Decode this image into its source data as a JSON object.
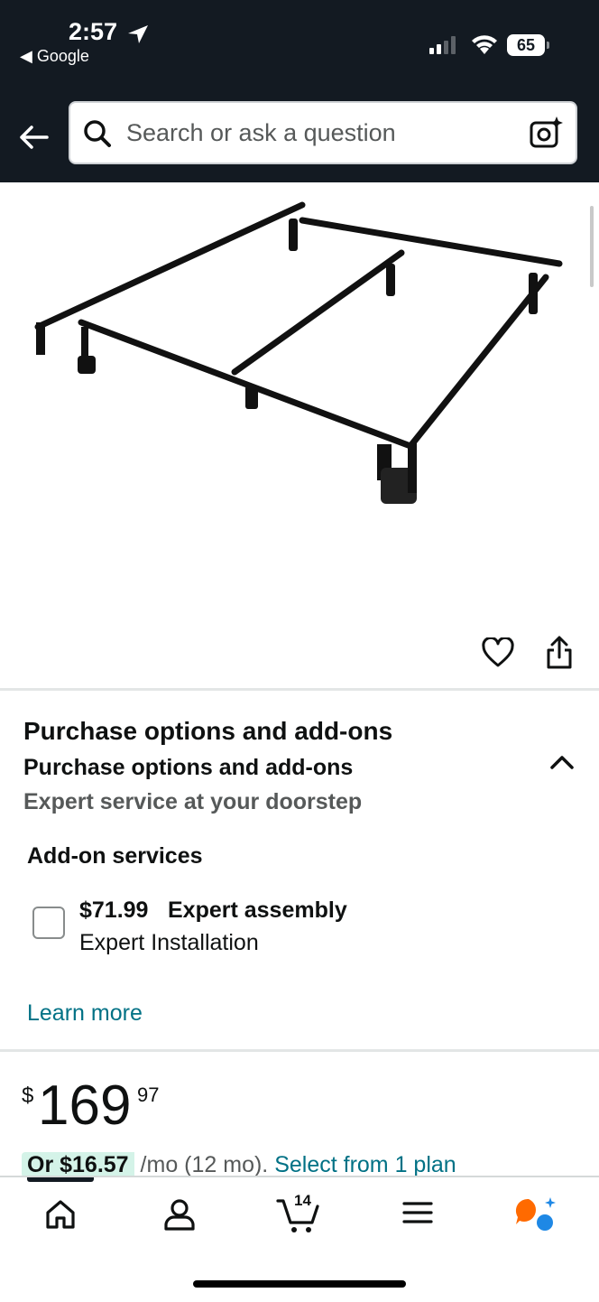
{
  "status_bar": {
    "time": "2:57",
    "back_app": "◀ Google",
    "battery": "65"
  },
  "header": {
    "search_placeholder": "Search or ask a question"
  },
  "product": {
    "image_alt": "Metal bed frame"
  },
  "purchase_options": {
    "title": "Purchase options and add-ons",
    "subtitle": "Purchase options and add-ons",
    "description": "Expert service at your doorstep",
    "addon_heading": "Add-on services",
    "addon": {
      "price": "$71.99",
      "name": "Expert assembly",
      "sub": "Expert Installation",
      "checked": false
    },
    "learn_more": "Learn more"
  },
  "price": {
    "currency": "$",
    "whole": "169",
    "fraction": "97",
    "monthly_prefix": "Or $16.57",
    "monthly_term": "/mo (12 mo).",
    "monthly_plan": "Select from 1 plan"
  },
  "bottom_nav": {
    "cart_count": "14"
  },
  "colors": {
    "header_bg": "#131a22",
    "link": "#007185",
    "assistant_orange": "#ff6a00",
    "assistant_blue": "#1e88e5"
  }
}
